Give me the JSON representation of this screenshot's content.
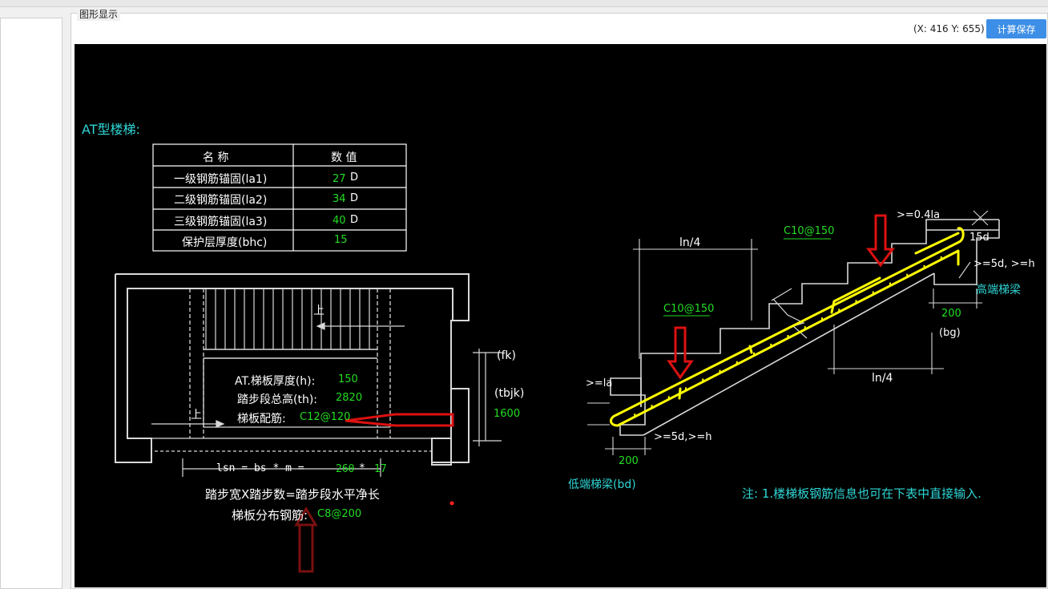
{
  "window": {
    "group_title": "图形显示",
    "coords": "(X: 416 Y: 655)",
    "save_button": "计算保存"
  },
  "drawing": {
    "title": "AT型楼梯:",
    "table": {
      "headers": [
        "名  称",
        "数  值"
      ],
      "rows": [
        {
          "name": "一级钢筋锚固(la1)",
          "value": "27",
          "unit": "D"
        },
        {
          "name": "二级钢筋锚固(la2)",
          "value": "34",
          "unit": "D"
        },
        {
          "name": "三级钢筋锚固(la3)",
          "value": "40",
          "unit": "D"
        },
        {
          "name": "保护层厚度(bhc)",
          "value": "15",
          "unit": ""
        }
      ]
    },
    "plan": {
      "up1": "上",
      "up2": "上",
      "thickness_label": "AT.梯板厚度(h):",
      "thickness_value": "150",
      "height_label": "踏步段总高(th):",
      "height_value": "2820",
      "rebar_label": "梯板配筋:",
      "rebar_value": "C12@120",
      "fk": "(fk)",
      "tbjk": "(tbjk)",
      "width_value": "1600",
      "lsn_label": "lsn = bs * m =",
      "bs_value": "260",
      "star": "*",
      "m_value": "17",
      "step_formula": "踏步宽X踏步数=踏步段水平净长",
      "dist_label": "梯板分布钢筋:",
      "dist_value": "C8@200"
    },
    "section": {
      "top_rebar": "C10@150",
      "bottom_rebar": "C10@150",
      "ln4_top": "ln/4",
      "ln4_bottom": "ln/4",
      "anchor_04": ">=0.4la",
      "d15": "15d",
      "anchor_5d_high": ">=5d, >=h",
      "high_beam": "高端梯梁",
      "dim200_high": "200",
      "bg": "(bg)",
      "la": ">=la",
      "anchor_5d_low": ">=5d,>=h",
      "dim200_low": "200",
      "low_beam": "低端梯梁(bd)"
    },
    "note": "注: 1.楼梯板钢筋信息也可在下表中直接输入."
  },
  "colors": {
    "canvas_bg": "#000000",
    "line": "#ffffff",
    "value": "#22dd22",
    "cyan_text": "#2fd6d6",
    "rebar": "#ffff00",
    "arrow": "#dd1111",
    "dark_arrow": "#7a1010",
    "button": "#3c8ee6"
  }
}
